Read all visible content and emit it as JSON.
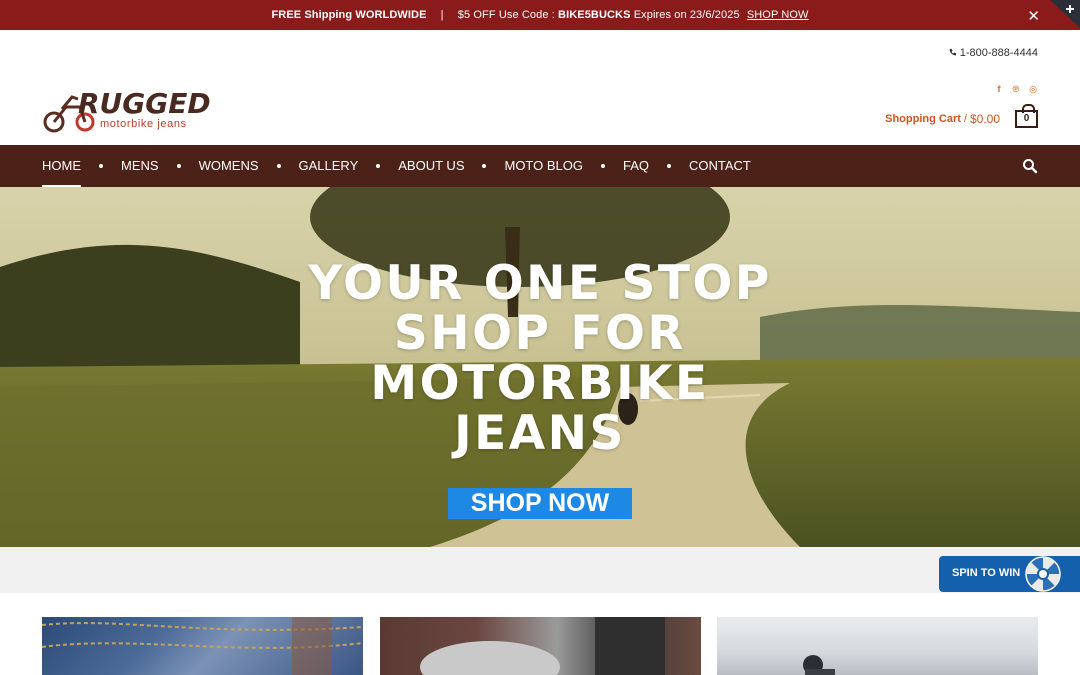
{
  "promo": {
    "free_shipping": "FREE Shipping WORLDWIDE",
    "separator": "|",
    "code_prefix": "$5 OFF Use Code :",
    "code": "BIKE5BUCKS",
    "expires": "Expires on 23/6/2025",
    "shop_now": "SHOP NOW",
    "close": "✕"
  },
  "header": {
    "phone": "1-800-888-4444",
    "logo_word": "RUGGED",
    "logo_sub": "motorbike jeans",
    "social_icons": [
      "facebook-icon",
      "pinterest-icon",
      "instagram-icon"
    ],
    "social_glyphs": [
      "f",
      "℗",
      "◎"
    ],
    "cart_label": "Shopping Cart",
    "cart_sep": "/",
    "cart_amount": "$0.00",
    "cart_count": "0"
  },
  "nav": {
    "items": [
      "HOME",
      "MENS",
      "WOMENS",
      "GALLERY",
      "ABOUT US",
      "MOTO BLOG",
      "FAQ",
      "CONTACT"
    ],
    "active": "HOME"
  },
  "hero": {
    "headline_lines": [
      "YOUR ONE STOP",
      "SHOP FOR",
      "MOTORBIKE",
      "JEANS"
    ],
    "cta": "SHOP NOW"
  },
  "spin": {
    "label": "SPIN TO WIN"
  },
  "colors": {
    "promo_bg": "#8b1a1a",
    "nav_bg": "#4b2118",
    "accent_orange": "#d3541f",
    "cta_blue": "#1e88e5",
    "spin_blue": "#1560ad"
  }
}
